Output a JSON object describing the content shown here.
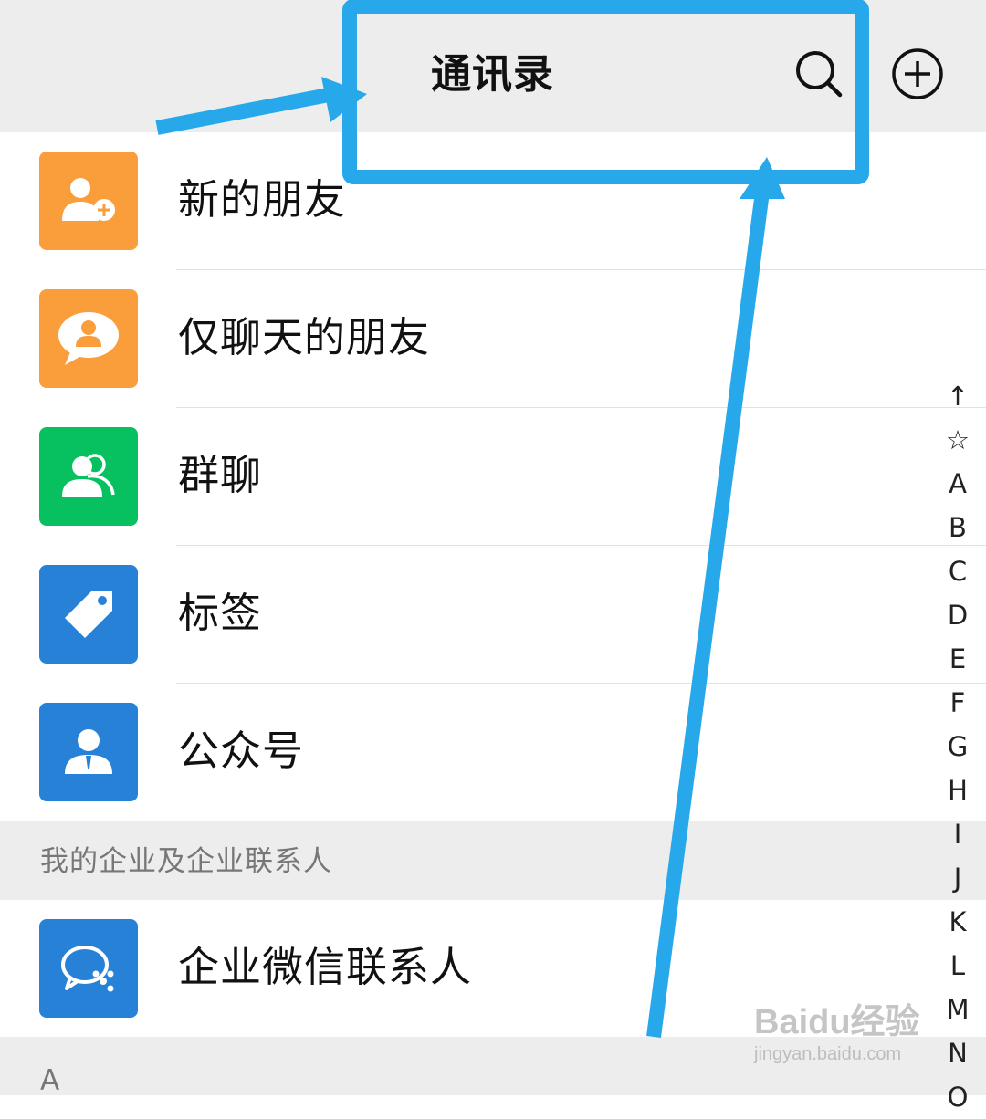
{
  "header": {
    "title": "通讯录",
    "search_icon": "search-icon",
    "add_icon": "plus-circle-icon"
  },
  "items": [
    {
      "label": "新的朋友",
      "icon": "add-friend-icon",
      "color": "#fa9d3b"
    },
    {
      "label": "仅聊天的朋友",
      "icon": "chat-only-friend-icon",
      "color": "#fa9d3b"
    },
    {
      "label": "群聊",
      "icon": "group-chat-icon",
      "color": "#07c160"
    },
    {
      "label": "标签",
      "icon": "tag-icon",
      "color": "#2782d7"
    },
    {
      "label": "公众号",
      "icon": "official-account-icon",
      "color": "#2782d7"
    }
  ],
  "enterprise_section": {
    "header": "我的企业及企业联系人",
    "item": {
      "label": "企业微信联系人",
      "icon": "wecom-contacts-icon",
      "color": "#2782d7"
    }
  },
  "letter_section": "A",
  "index_bar": [
    "↑",
    "☆",
    "A",
    "B",
    "C",
    "D",
    "E",
    "F",
    "G",
    "H",
    "I",
    "J",
    "K",
    "L",
    "M",
    "N",
    "O"
  ],
  "annotation": {
    "color": "#27a8ea"
  },
  "watermark": {
    "main": "Baidu经验",
    "sub": "jingyan.baidu.com"
  }
}
